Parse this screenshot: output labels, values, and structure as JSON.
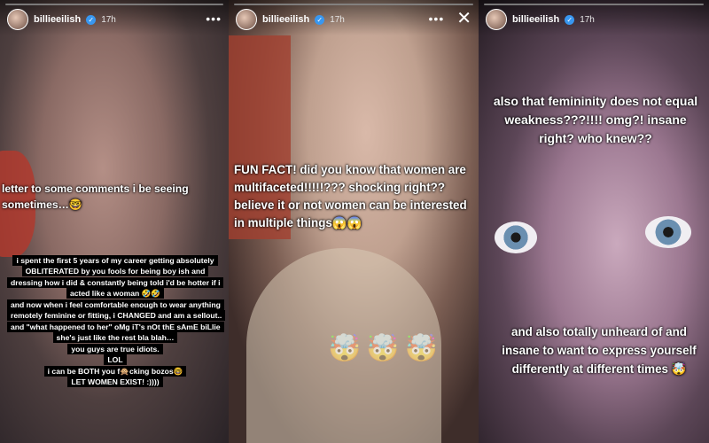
{
  "stories": [
    {
      "username": "billieeilish",
      "time": "17h",
      "more": "•••",
      "caption_top": "letter to some comments i be seeing sometimes…🤓",
      "boxed_lines": [
        "i spent the first 5 years of my career getting absolutely OBLITERATED by you fools for being boy ish and dressing how i did & constantly being told i'd be hotter if i acted like a woman 🤣🤣",
        "and now when i feel comfortable enough to wear anything remotely feminine or fitting, i CHANGED and am a sellout.. and \"what happened to her\" oMg iT's nOt thE sAmE biLlie she's just like the rest bla blah…",
        "you guys are true idiots.",
        "LOL",
        "i can be BOTH you f🙊cking bozos🤓",
        "LET WOMEN EXIST! :))))"
      ]
    },
    {
      "username": "billieeilish",
      "time": "17h",
      "more": "•••",
      "close": "✕",
      "caption": "FUN FACT! did you know that women are multifaceted!!!!!??? shocking right?? believe it or not women can be interested in multiple things😱😱",
      "emojis": [
        "🤯",
        "🤯",
        "🤯"
      ]
    },
    {
      "username": "billieeilish",
      "time": "17h",
      "caption_top": "also that femininity does not equal weakness???!!!! omg?! insane right? who knew??",
      "caption_bottom": "and also totally unheard of and insane to want to express yourself differently at different times 🤯"
    }
  ],
  "colors": {
    "verified": "#3897f0",
    "text": "#ffffff",
    "box": "#000000"
  }
}
